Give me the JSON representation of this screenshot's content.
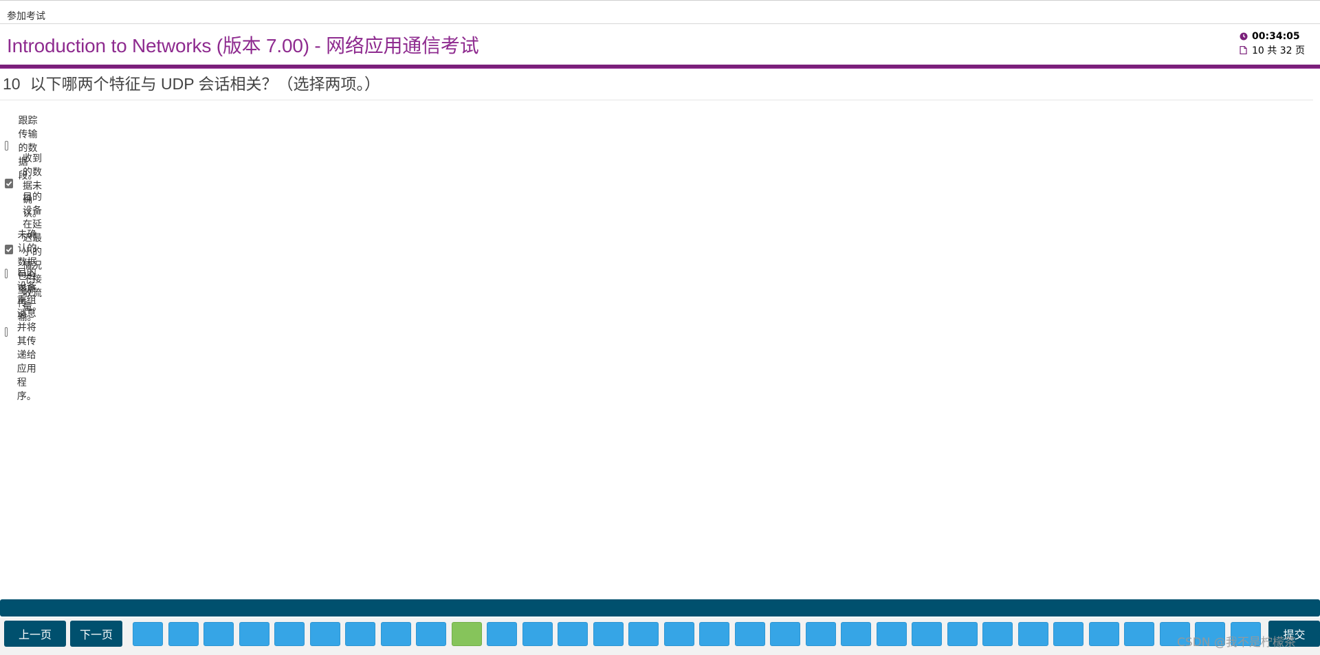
{
  "breadcrumb": "参加考试",
  "exam_title": "Introduction to Networks (版本 7.00) - 网络应用通信考试",
  "status": {
    "timer": "00:34:05",
    "page_info": "10 共 32 页",
    "clock_icon": "clock-icon",
    "page_icon": "page-icon"
  },
  "question": {
    "number": "10",
    "text": "以下哪两个特征与 UDP 会话相关？（选择两项。）",
    "options": [
      {
        "label": "跟踪传输的数据段。",
        "checked": false
      },
      {
        "label": "收到的数据未确认。",
        "checked": true
      },
      {
        "label": "目的设备在延迟最小的情况下接收流量。",
        "checked": true
      },
      {
        "label": "未确认的数据包会重新传输。",
        "checked": false
      },
      {
        "label": "目的设备重组消息并将其传递给应用程序。",
        "checked": false
      }
    ]
  },
  "footer": {
    "prev_label": "上一页",
    "next_label": "下一页",
    "submit_label": "提交",
    "visible_page_buttons": 32,
    "current_page": 10
  },
  "watermark": "CSDN @我不是柠檬茶",
  "colors": {
    "title": "#8e2b8f",
    "accent_bar": "#7a1f7a",
    "nav": "#00506e",
    "page_button": "#36a5e6",
    "current_page_button": "#86c45b"
  }
}
